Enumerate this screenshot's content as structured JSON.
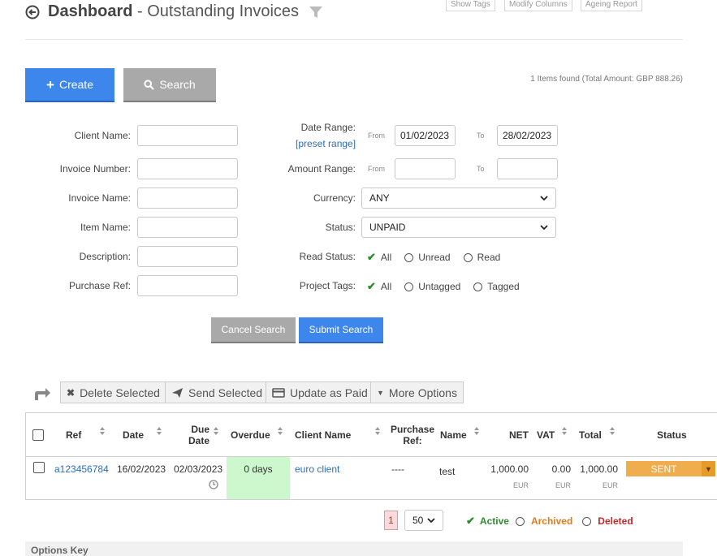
{
  "header": {
    "title_main": "Dashboard",
    "title_sep": " - ",
    "title_sub": "Outstanding Invoices",
    "links": [
      "Show Tags",
      "Modify Columns",
      "Ageing Report"
    ]
  },
  "actions": {
    "create": "Create",
    "search": "Search",
    "items_found": "1 Items found (Total Amount: GBP 888.26)"
  },
  "form": {
    "client_name": "Client Name:",
    "invoice_number": "Invoice Number:",
    "invoice_name": "Invoice Name:",
    "item_name": "Item Name:",
    "description": "Description:",
    "purchase_ref": "Purchase Ref:",
    "date_range": "Date Range:",
    "preset_range": "[preset range]",
    "from": "From",
    "to": "To",
    "date_from": "01/02/2023",
    "date_to": "28/02/2023",
    "amount_range": "Amount Range:",
    "currency": "Currency:",
    "currency_value": "ANY",
    "status": "Status:",
    "status_value": "UNPAID",
    "read_status": "Read Status:",
    "read_options": [
      "All",
      "Unread",
      "Read"
    ],
    "project_tags": "Project Tags:",
    "tag_options": [
      "All",
      "Untagged",
      "Tagged"
    ],
    "cancel": "Cancel Search",
    "submit": "Submit Search"
  },
  "toolbar": {
    "delete": "Delete Selected",
    "send": "Send Selected",
    "update_paid": "Update as Paid",
    "more": "More Options"
  },
  "table": {
    "headers": {
      "ref": "Ref",
      "date": "Date",
      "due_date_1": "Due",
      "due_date_2": "Date",
      "overdue": "Overdue",
      "client_name": "Client Name",
      "purchase_ref_1": "Purchase",
      "purchase_ref_2": "Ref:",
      "name": "Name",
      "net": "NET",
      "vat": "VAT",
      "total": "Total",
      "status": "Status"
    },
    "row": {
      "ref": "a123456784",
      "date": "16/02/2023",
      "due_date": "02/03/2023",
      "overdue": "0 days",
      "client_name": "euro client",
      "purchase_ref": "----",
      "name": "test",
      "net": "1,000.00",
      "vat": "0.00",
      "total": "1,000.00",
      "currency": "EUR",
      "status": "SENT"
    }
  },
  "pagination": {
    "page": "1",
    "per_page": "50",
    "active": "Active",
    "archived": "Archived",
    "deleted": "Deleted"
  },
  "options_key": "Options Key",
  "colors": {
    "primary": "#3d86ec",
    "grey_button": "#a9a9a9",
    "status_sent": "#f0ad4e",
    "overdue_ok": "#cdf8cd",
    "link": "#2a6ebb"
  }
}
